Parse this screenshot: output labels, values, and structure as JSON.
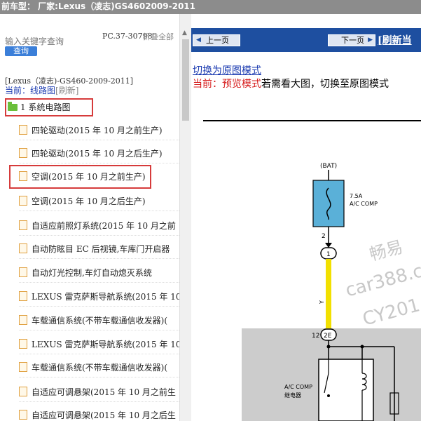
{
  "header": {
    "title": "前车型：  厂家:Lexus（凌志)GS4602009-2011"
  },
  "search": {
    "placeholder": "输入关键字查询",
    "button": "查询"
  },
  "pc_code": "PC.37-30798",
  "fold_label": "折叠全部",
  "breadcrumb": "[Lexus（凌志)-GS460-2009-2011]",
  "current": {
    "label": "当前：",
    "link": "线路图",
    "refresh": "[刷新]"
  },
  "tree": {
    "root": "1 系统电路图",
    "items": [
      {
        "label": "四轮驱动(2015 年 10 月之前生产)"
      },
      {
        "label": "四轮驱动(2015 年 10 月之后生产)"
      },
      {
        "label": "空调(2015 年 10 月之前生产)"
      },
      {
        "label": "空调(2015 年 10 月之后生产)"
      },
      {
        "label": "自适应前照灯系统(2015 年 10 月之前"
      },
      {
        "label": "自动防眩目 EC 后视镜,车库门开启器"
      },
      {
        "label": "自动灯光控制,车灯自动熄灭系统"
      },
      {
        "label": "LEXUS 雷克萨斯导航系统(2015 年 10"
      },
      {
        "label": "车载通信系统(不带车载通信收发器)("
      },
      {
        "label": "LEXUS 雷克萨斯导航系统(2015 年 10"
      },
      {
        "label": "车载通信系统(不带车载通信收发器)("
      },
      {
        "label": "自适应可调悬架(2015 年 10 月之前生"
      },
      {
        "label": "自适应可调悬架(2015 年 10 月之后生"
      }
    ]
  },
  "viewer": {
    "prev": "上一页",
    "next": "下一页",
    "refresh": "[刷新当",
    "mode_link": "切换为原图模式",
    "mode_prefix": "当前：",
    "mode_name": "预览模式",
    "mode_hint": "若需看大图，切换至原图模式"
  },
  "diagram": {
    "bat": "(BAT)",
    "fuse_rating": "7.5A",
    "fuse_name": "A/C COMP",
    "pin_top": "2",
    "conn_1": "1",
    "wire_color": "Y",
    "pin_12": "12",
    "conn_2e": "2E",
    "relay_name_1": "A/C COMP",
    "relay_name_2": "继电器",
    "watermark_1": "畅易",
    "watermark_2": "car388.c",
    "watermark_3": "CY201"
  },
  "colors": {
    "nav_bg": "#1e4fa0",
    "highlight": "#d63b3b",
    "wire_yellow": "#f2e000",
    "fuse_fill": "#5ab0d8",
    "relay_bg": "#cccccc"
  }
}
